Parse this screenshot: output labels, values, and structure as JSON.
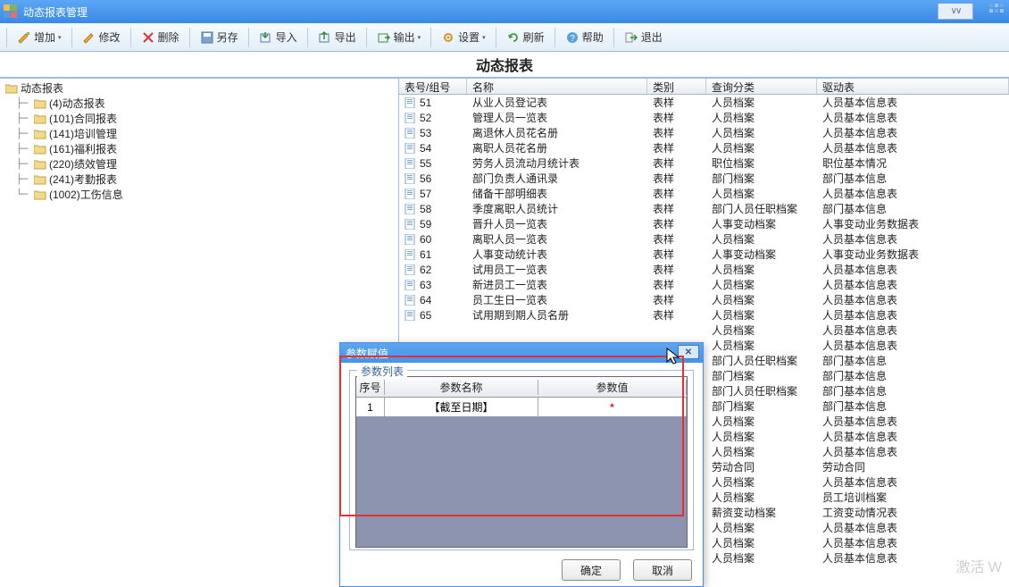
{
  "window": {
    "title": "动态报表管理"
  },
  "toolbar": {
    "add": "增加",
    "edit": "修改",
    "delete": "删除",
    "saveas": "另存",
    "import": "导入",
    "export": "导出",
    "output": "输出",
    "settings": "设置",
    "refresh": "刷新",
    "help": "帮助",
    "exit": "退出"
  },
  "page": {
    "title": "动态报表"
  },
  "tree": {
    "root": "动态报表",
    "children": [
      "(4)动态报表",
      "(101)合同报表",
      "(141)培训管理",
      "(161)福利报表",
      "(220)绩效管理",
      "(241)考勤报表",
      "(1002)工伤信息"
    ]
  },
  "grid": {
    "headers": {
      "id": "表号/组号",
      "name": "名称",
      "type": "类别",
      "query": "查询分类",
      "drive": "驱动表"
    },
    "rows": [
      {
        "id": "51",
        "name": "从业人员登记表",
        "type": "表样",
        "query": "人员档案",
        "drive": "人员基本信息表"
      },
      {
        "id": "52",
        "name": "管理人员一览表",
        "type": "表样",
        "query": "人员档案",
        "drive": "人员基本信息表"
      },
      {
        "id": "53",
        "name": "离退休人员花名册",
        "type": "表样",
        "query": "人员档案",
        "drive": "人员基本信息表"
      },
      {
        "id": "54",
        "name": "离职人员花名册",
        "type": "表样",
        "query": "人员档案",
        "drive": "人员基本信息表"
      },
      {
        "id": "55",
        "name": "劳务人员流动月统计表",
        "type": "表样",
        "query": "职位档案",
        "drive": "职位基本情况"
      },
      {
        "id": "56",
        "name": "部门负责人通讯录",
        "type": "表样",
        "query": "部门档案",
        "drive": "部门基本信息"
      },
      {
        "id": "57",
        "name": "储备干部明细表",
        "type": "表样",
        "query": "人员档案",
        "drive": "人员基本信息表"
      },
      {
        "id": "58",
        "name": "季度离职人员统计",
        "type": "表样",
        "query": "部门人员任职档案",
        "drive": "部门基本信息"
      },
      {
        "id": "59",
        "name": "晋升人员一览表",
        "type": "表样",
        "query": "人事变动档案",
        "drive": "人事变动业务数据表"
      },
      {
        "id": "60",
        "name": "离职人员一览表",
        "type": "表样",
        "query": "人员档案",
        "drive": "人员基本信息表"
      },
      {
        "id": "61",
        "name": "人事变动统计表",
        "type": "表样",
        "query": "人事变动档案",
        "drive": "人事变动业务数据表"
      },
      {
        "id": "62",
        "name": "试用员工一览表",
        "type": "表样",
        "query": "人员档案",
        "drive": "人员基本信息表"
      },
      {
        "id": "63",
        "name": "新进员工一览表",
        "type": "表样",
        "query": "人员档案",
        "drive": "人员基本信息表"
      },
      {
        "id": "64",
        "name": "员工生日一览表",
        "type": "表样",
        "query": "人员档案",
        "drive": "人员基本信息表"
      },
      {
        "id": "65",
        "name": "试用期到期人员名册",
        "type": "表样",
        "query": "人员档案",
        "drive": "人员基本信息表"
      },
      {
        "id": "",
        "name": "",
        "type": "",
        "query": "人员档案",
        "drive": "人员基本信息表"
      },
      {
        "id": "",
        "name": "",
        "type": "",
        "query": "人员档案",
        "drive": "人员基本信息表"
      },
      {
        "id": "",
        "name": "",
        "type": "",
        "query": "部门人员任职档案",
        "drive": "部门基本信息"
      },
      {
        "id": "",
        "name": "",
        "type": "",
        "query": "部门档案",
        "drive": "部门基本信息"
      },
      {
        "id": "",
        "name": "",
        "type": "",
        "query": "部门人员任职档案",
        "drive": "部门基本信息"
      },
      {
        "id": "",
        "name": "",
        "type": "",
        "query": "部门档案",
        "drive": "部门基本信息"
      },
      {
        "id": "",
        "name": "",
        "type": "",
        "query": "人员档案",
        "drive": "人员基本信息表"
      },
      {
        "id": "",
        "name": "",
        "type": "",
        "query": "人员档案",
        "drive": "人员基本信息表"
      },
      {
        "id": "",
        "name": "",
        "type": "",
        "query": "人员档案",
        "drive": "人员基本信息表"
      },
      {
        "id": "",
        "name": "",
        "type": "",
        "query": "劳动合同",
        "drive": "劳动合同"
      },
      {
        "id": "",
        "name": "",
        "type": "",
        "query": "人员档案",
        "drive": "人员基本信息表"
      },
      {
        "id": "",
        "name": "",
        "type": "",
        "query": "人员档案",
        "drive": "员工培训档案"
      },
      {
        "id": "",
        "name": "",
        "type": "",
        "query": "薪资变动档案",
        "drive": "工资变动情况表"
      },
      {
        "id": "",
        "name": "",
        "type": "",
        "query": "人员档案",
        "drive": "人员基本信息表"
      },
      {
        "id": "",
        "name": "",
        "type": "",
        "query": "人员档案",
        "drive": "人员基本信息表"
      },
      {
        "id": "",
        "name": "",
        "type": "",
        "query": "人员档案",
        "drive": "人员基本信息表"
      }
    ]
  },
  "dialog": {
    "title": "参数赋值",
    "legend": "参数列表",
    "headers": {
      "seq": "序号",
      "name": "参数名称",
      "value": "参数值"
    },
    "row": {
      "seq": "1",
      "name": "【截至日期】",
      "value_marker": "*"
    },
    "ok": "确定",
    "cancel": "取消"
  },
  "watermark": "激活 W"
}
